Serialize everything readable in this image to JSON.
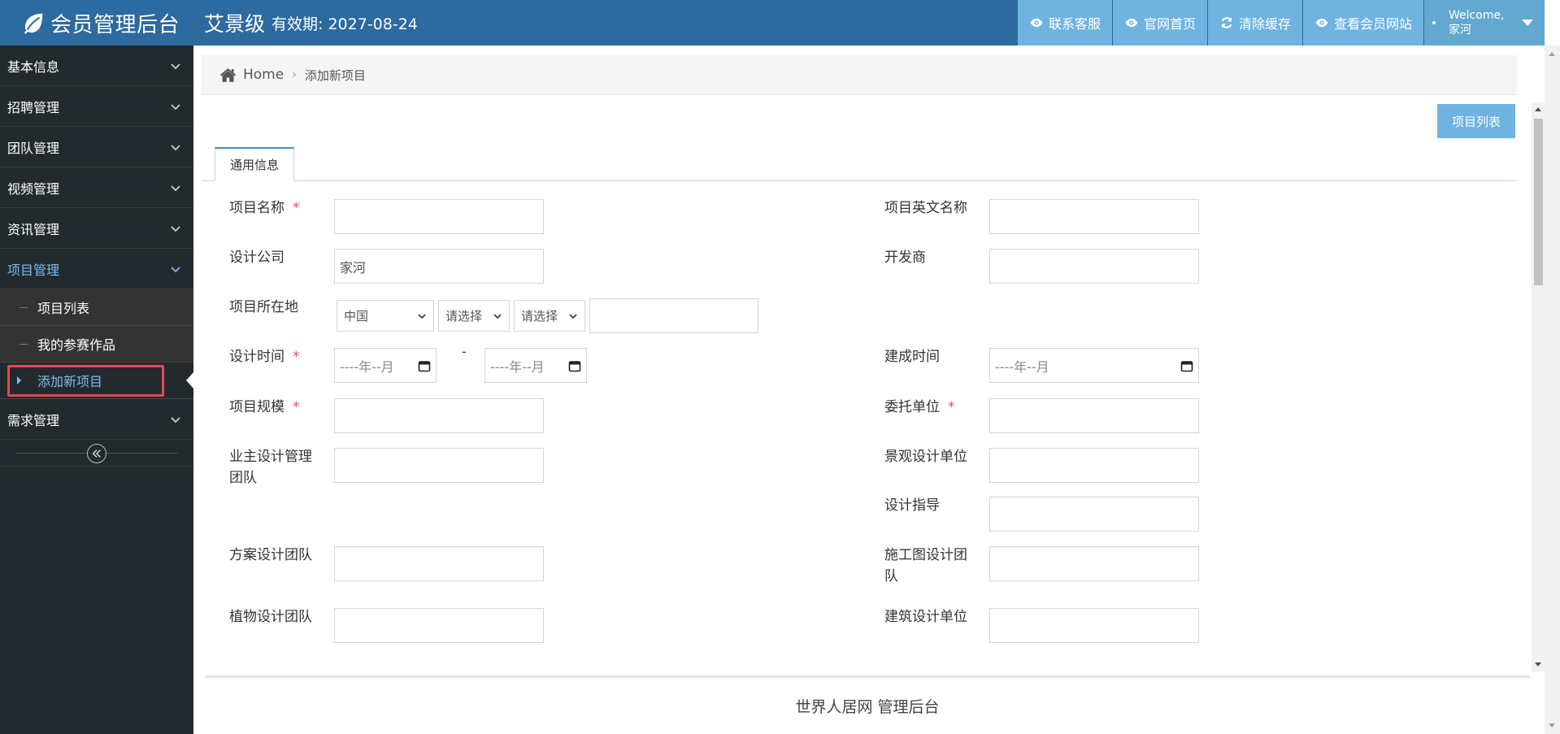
{
  "header": {
    "brand_title": "会员管理后台",
    "org_name": "艾景级",
    "expiry": "有效期: 2027-08-24",
    "buttons": [
      {
        "label": "联系客服",
        "icon": "eye-icon"
      },
      {
        "label": "官网首页",
        "icon": "eye-icon"
      },
      {
        "label": "清除缓存",
        "icon": "refresh-icon"
      },
      {
        "label": "查看会员网站",
        "icon": "eye-icon"
      }
    ],
    "user": {
      "welcome": "Welcome,",
      "name": "家河"
    }
  },
  "sidebar": {
    "items": [
      {
        "label": "基本信息"
      },
      {
        "label": "招聘管理"
      },
      {
        "label": "团队管理"
      },
      {
        "label": "视频管理"
      },
      {
        "label": "资讯管理"
      },
      {
        "label": "项目管理"
      },
      {
        "label": "需求管理"
      }
    ],
    "project_sub": [
      "项目列表",
      "我的参赛作品",
      "添加新项目"
    ]
  },
  "breadcrumb": {
    "home": "Home",
    "current": "添加新项目"
  },
  "list_button": "项目列表",
  "tab": "通用信息",
  "form": {
    "project_name": "项目名称",
    "project_en_name": "项目英文名称",
    "design_company": "设计公司",
    "design_company_value": "家河",
    "developer": "开发商",
    "location": "项目所在地",
    "country": "中国",
    "province": "请选择",
    "city": "请选择",
    "design_time": "设计时间",
    "date_placeholder": "----年--月",
    "range_dash": "-",
    "completion_time": "建成时间",
    "scale": "项目规模",
    "client": "委托单位",
    "owner_team": "业主设计管理团队",
    "landscape_unit": "景观设计单位",
    "guidance": "设计指导",
    "scheme_team": "方案设计团队",
    "construction_team": "施工图设计团队",
    "plant_team": "植物设计团队",
    "architecture_unit": "建筑设计单位",
    "required_mark": "*"
  },
  "footer": "世界人居网 管理后台",
  "colors": {
    "navbar": "#2c6aa0",
    "nav_button": "#6fb3e0",
    "sidebar": "#222a2d",
    "accent": "#7dbcf3",
    "required": "#e8474f"
  }
}
